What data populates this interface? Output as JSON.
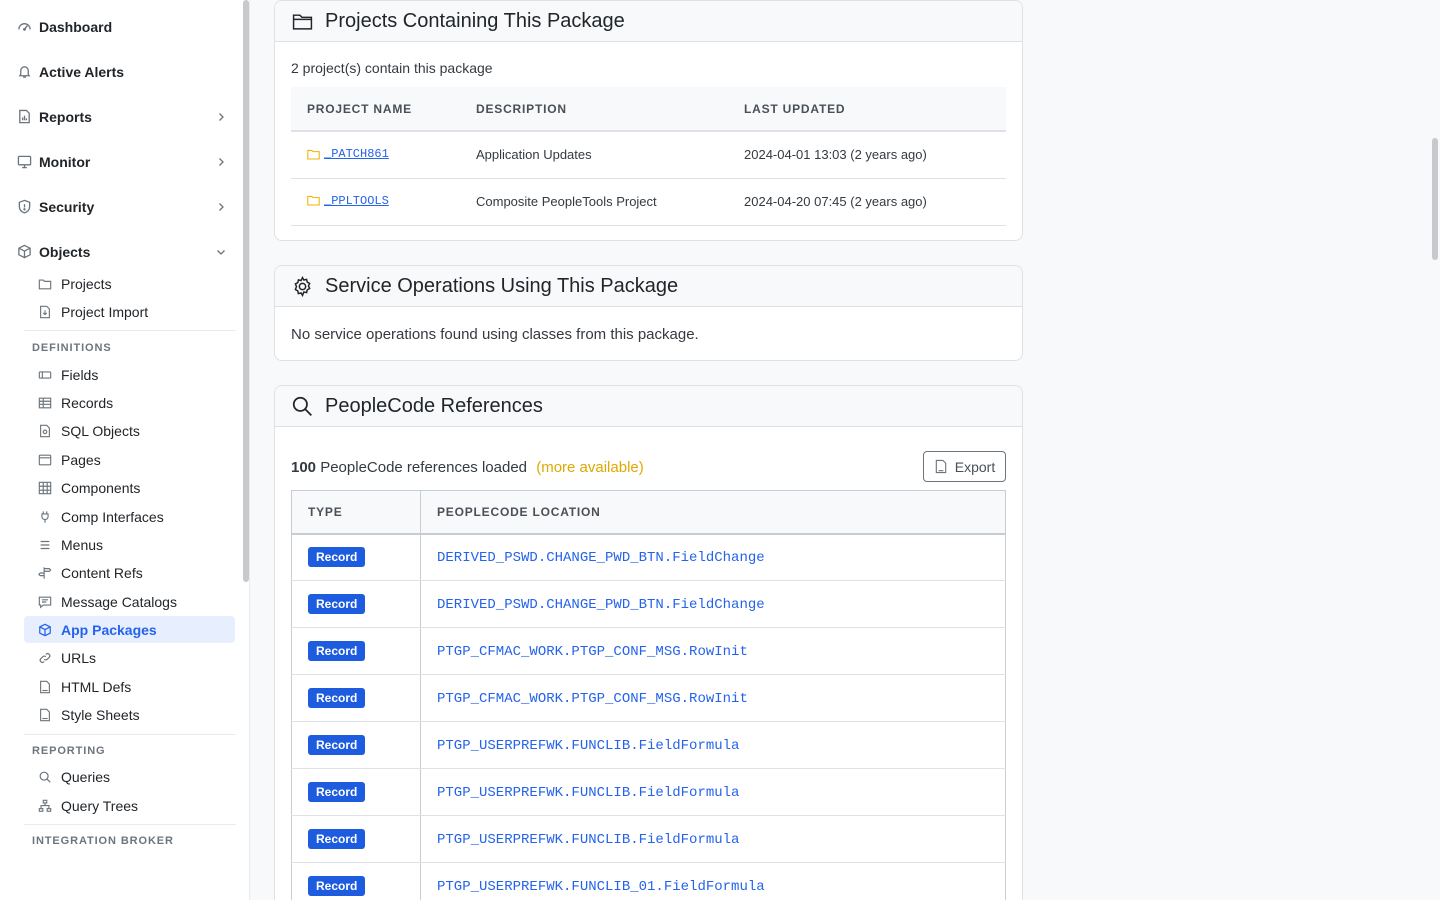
{
  "sidebar": {
    "top_items": [
      {
        "label": "Dashboard",
        "icon": "gauge-icon"
      },
      {
        "label": "Active Alerts",
        "icon": "bell-icon"
      },
      {
        "label": "Reports",
        "icon": "report-icon"
      },
      {
        "label": "Monitor",
        "icon": "monitor-icon"
      },
      {
        "label": "Security",
        "icon": "shield-icon"
      },
      {
        "label": "Objects",
        "icon": "box-icon"
      }
    ],
    "objects_items": [
      {
        "label": "Projects",
        "icon": "folder-icon"
      },
      {
        "label": "Project Import",
        "icon": "file-import-icon"
      }
    ],
    "definitions_label": "DEFINITIONS",
    "definitions_items": [
      {
        "label": "Fields",
        "icon": "field-icon"
      },
      {
        "label": "Records",
        "icon": "table-icon"
      },
      {
        "label": "SQL Objects",
        "icon": "sql-file-icon"
      },
      {
        "label": "Pages",
        "icon": "window-icon"
      },
      {
        "label": "Components",
        "icon": "grid-icon"
      },
      {
        "label": "Comp Interfaces",
        "icon": "plug-icon"
      },
      {
        "label": "Menus",
        "icon": "menu-icon"
      },
      {
        "label": "Content Refs",
        "icon": "signpost-icon"
      },
      {
        "label": "Message Catalogs",
        "icon": "message-icon"
      },
      {
        "label": "App Packages",
        "icon": "package-icon",
        "active": true
      },
      {
        "label": "URLs",
        "icon": "link-icon"
      },
      {
        "label": "HTML Defs",
        "icon": "html-file-icon"
      },
      {
        "label": "Style Sheets",
        "icon": "css-file-icon"
      }
    ],
    "reporting_label": "REPORTING",
    "reporting_items": [
      {
        "label": "Queries",
        "icon": "search-icon"
      },
      {
        "label": "Query Trees",
        "icon": "tree-icon"
      }
    ],
    "integration_label": "INTEGRATION BROKER"
  },
  "projects_card": {
    "title": "Projects Containing This Package",
    "summary": "2 project(s) contain this package",
    "columns": [
      "PROJECT NAME",
      "DESCRIPTION",
      "LAST UPDATED"
    ],
    "rows": [
      {
        "name": "_PATCH861",
        "description": "Application Updates",
        "updated": "2024-04-01 13:03 (2 years ago)"
      },
      {
        "name": "_PPLTOOLS",
        "description": "Composite PeopleTools Project",
        "updated": "2024-04-20 07:45 (2 years ago)"
      }
    ]
  },
  "service_card": {
    "title": "Service Operations Using This Package",
    "message": "No service operations found using classes from this package."
  },
  "peoplecode_card": {
    "title": "PeopleCode References",
    "count": "100",
    "count_suffix": "PeopleCode references loaded",
    "more_label": "(more available)",
    "export_label": "Export",
    "columns": [
      "TYPE",
      "PEOPLECODE LOCATION"
    ],
    "rows": [
      {
        "type": "Record",
        "location": "DERIVED_PSWD.CHANGE_PWD_BTN.FieldChange"
      },
      {
        "type": "Record",
        "location": "DERIVED_PSWD.CHANGE_PWD_BTN.FieldChange"
      },
      {
        "type": "Record",
        "location": "PTGP_CFMAC_WORK.PTGP_CONF_MSG.RowInit"
      },
      {
        "type": "Record",
        "location": "PTGP_CFMAC_WORK.PTGP_CONF_MSG.RowInit"
      },
      {
        "type": "Record",
        "location": "PTGP_USERPREFWK.FUNCLIB.FieldFormula"
      },
      {
        "type": "Record",
        "location": "PTGP_USERPREFWK.FUNCLIB.FieldFormula"
      },
      {
        "type": "Record",
        "location": "PTGP_USERPREFWK.FUNCLIB.FieldFormula"
      },
      {
        "type": "Record",
        "location": "PTGP_USERPREFWK.FUNCLIB_01.FieldFormula"
      }
    ]
  },
  "colors": {
    "accent": "#2563eb",
    "badge": "#1d5bdf",
    "more_available": "#e0a800",
    "folder": "#f0b400"
  }
}
